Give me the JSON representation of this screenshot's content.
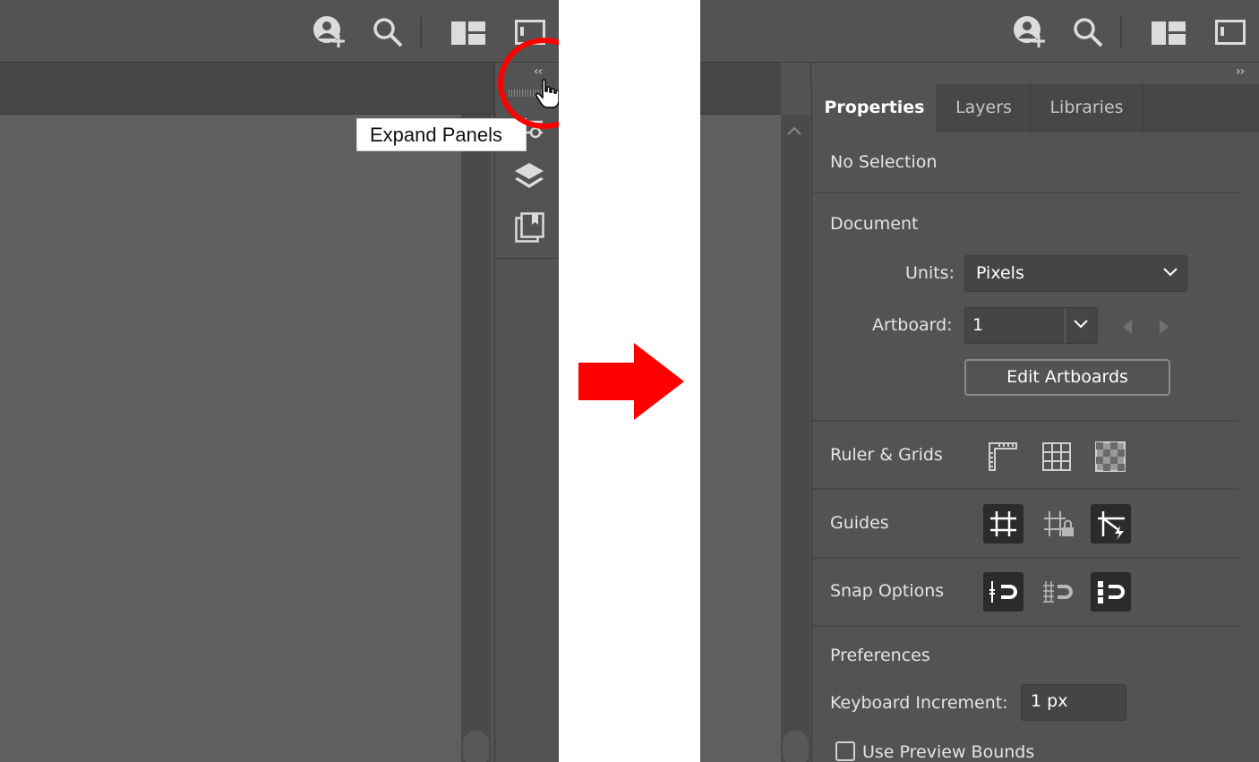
{
  "left_panel": {
    "collapse_button": "‹‹",
    "tooltip": "Expand Panels"
  },
  "right_panel": {
    "collapse_button": "››",
    "tabs": [
      "Properties",
      "Layers",
      "Libraries"
    ],
    "active_tab": "Properties",
    "selection_status": "No Selection",
    "document": {
      "heading": "Document",
      "units_label": "Units:",
      "units_value": "Pixels",
      "artboard_label": "Artboard:",
      "artboard_value": "1",
      "edit_artboards": "Edit Artboards"
    },
    "ruler_grids_label": "Ruler & Grids",
    "guides_label": "Guides",
    "snap_options_label": "Snap Options",
    "preferences": {
      "heading": "Preferences",
      "keyboard_increment_label": "Keyboard Increment:",
      "keyboard_increment_value": "1 px",
      "use_preview_bounds": "Use Preview Bounds"
    }
  },
  "colors": {
    "annotation_red": "#ff0000",
    "ui_background": "#535353",
    "canvas": "#5f5f5f"
  }
}
